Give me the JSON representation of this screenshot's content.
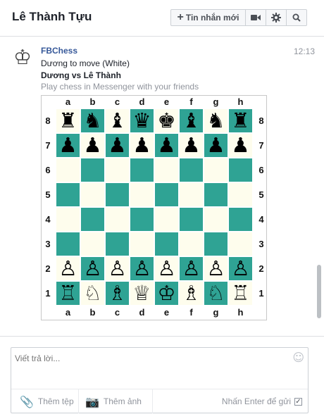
{
  "header": {
    "title": "Lê Thành Tựu",
    "new_message_label": "Tin nhắn mới",
    "new_message_icon": "+"
  },
  "message": {
    "sender": "FBChess",
    "time": "12:13",
    "line1": "Dương to move (White)",
    "line2": "Dương vs Lê Thành",
    "line3": "Play chess in Messenger with your friends"
  },
  "chess_board": {
    "files": [
      "a",
      "b",
      "c",
      "d",
      "e",
      "f",
      "g",
      "h"
    ],
    "ranks": [
      "8",
      "7",
      "6",
      "5",
      "4",
      "3",
      "2",
      "1"
    ],
    "pieces": [
      [
        "♜",
        "♞",
        "♝",
        "♛",
        "♚",
        "♝",
        "♞",
        "♜"
      ],
      [
        "♟",
        "♟",
        "♟",
        "♟",
        "♟",
        "♟",
        "♟",
        "♟"
      ],
      [
        "",
        "",
        "",
        "",
        "",
        "",
        "",
        ""
      ],
      [
        "",
        "",
        "",
        "",
        "",
        "",
        "",
        ""
      ],
      [
        "",
        "",
        "",
        "",
        "",
        "",
        "",
        ""
      ],
      [
        "",
        "",
        "",
        "",
        "",
        "",
        "",
        ""
      ],
      [
        "♙",
        "♙",
        "♙",
        "♙",
        "♙",
        "♙",
        "♙",
        "♙"
      ],
      [
        "♖",
        "♘",
        "♗",
        "♕",
        "♔",
        "♗",
        "♘",
        "♖"
      ]
    ]
  },
  "composer": {
    "placeholder": "Viết trả lời...",
    "add_file_label": "Thêm tệp",
    "add_photo_label": "Thêm ảnh",
    "enter_to_send_label": "Nhấn Enter để gửi",
    "enter_to_send_checked": true
  },
  "colors": {
    "light_square": "#fefded",
    "dark_square": "#2fa394",
    "link_blue": "#365899"
  }
}
